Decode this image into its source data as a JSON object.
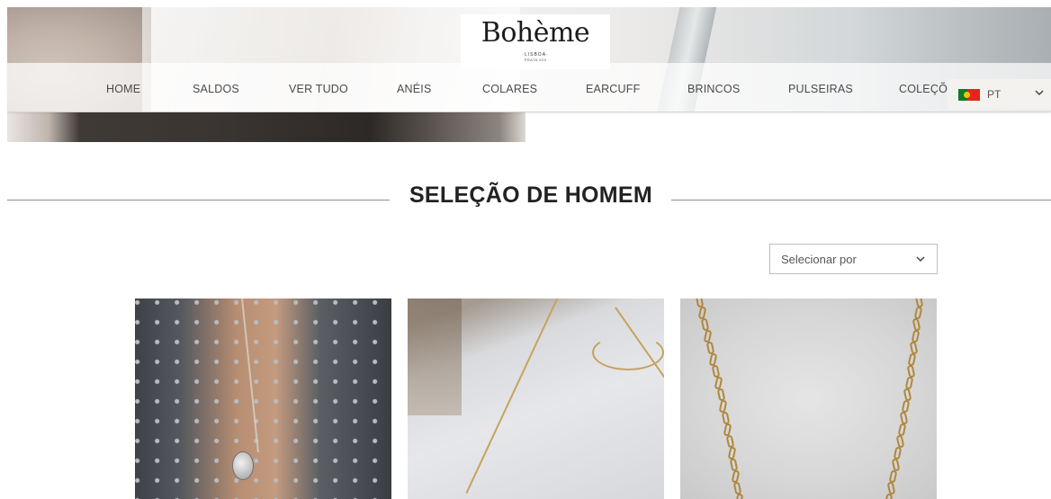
{
  "brand": {
    "name": "Bohème",
    "city": "·LISBOA·",
    "material": "PRATA 925"
  },
  "nav": {
    "items": [
      {
        "label": "HOME"
      },
      {
        "label": "SALDOS"
      },
      {
        "label": "VER TUDO"
      },
      {
        "label": "ANÉIS"
      },
      {
        "label": "COLARES"
      },
      {
        "label": "EARCUFF"
      },
      {
        "label": "BRINCOS"
      },
      {
        "label": "PULSEIRAS"
      },
      {
        "label": "COLEÇÕES"
      }
    ]
  },
  "language": {
    "code": "PT",
    "flag_icon": "portugal-flag-icon"
  },
  "section": {
    "title": "SELEÇÃO DE HOMEM"
  },
  "sort": {
    "selected": "Selecionar por"
  },
  "products": [
    {
      "image": "man-wearing-silver-medallion-necklace"
    },
    {
      "image": "gold-chain-necklaces-on-table"
    },
    {
      "image": "gold-link-chain-on-marble"
    }
  ],
  "colors": {
    "text": "#222222",
    "nav_text": "#4a4a4a",
    "chain_gold": "#b0873d"
  }
}
